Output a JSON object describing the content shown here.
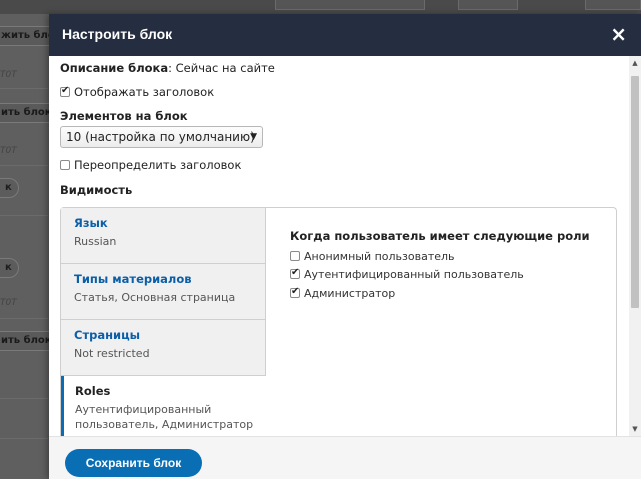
{
  "background": {
    "button_labels": [
      "жить бло",
      "ить блок",
      "ить блок"
    ],
    "pill_labels": [
      "к",
      "к"
    ],
    "italic_labels": [
      "T0T",
      "T0T",
      "T0T"
    ]
  },
  "dialog": {
    "title": "Настроить блок",
    "close_icon": "×",
    "description_label": "Описание блока",
    "description_value": ": Сейчас на сайте",
    "show_title_label": "Отображать заголовок",
    "items_per_block_label": "Элементов на блок",
    "items_per_block_value": "10 (настройка по умолчанию)",
    "override_title_label": "Переопределить заголовок",
    "visibility_label": "Видимость",
    "tabs": [
      {
        "title": "Язык",
        "summary": "Russian"
      },
      {
        "title": "Типы материалов",
        "summary": "Статья, Основная страница"
      },
      {
        "title": "Страницы",
        "summary": "Not restricted"
      },
      {
        "title": "Roles",
        "summary": "Аутентифицированный пользователь, Администратор"
      }
    ],
    "roles_heading": "Когда пользователь имеет следующие роли",
    "roles": [
      {
        "label": "Анонимный пользователь",
        "checked": false
      },
      {
        "label": "Аутентифицированный пользователь",
        "checked": true
      },
      {
        "label": "Администратор",
        "checked": true
      }
    ],
    "save_label": "Сохранить блок"
  },
  "colors": {
    "titlebar": "#252d40",
    "accent": "#0a6eb4",
    "link": "#0b5ea8"
  }
}
